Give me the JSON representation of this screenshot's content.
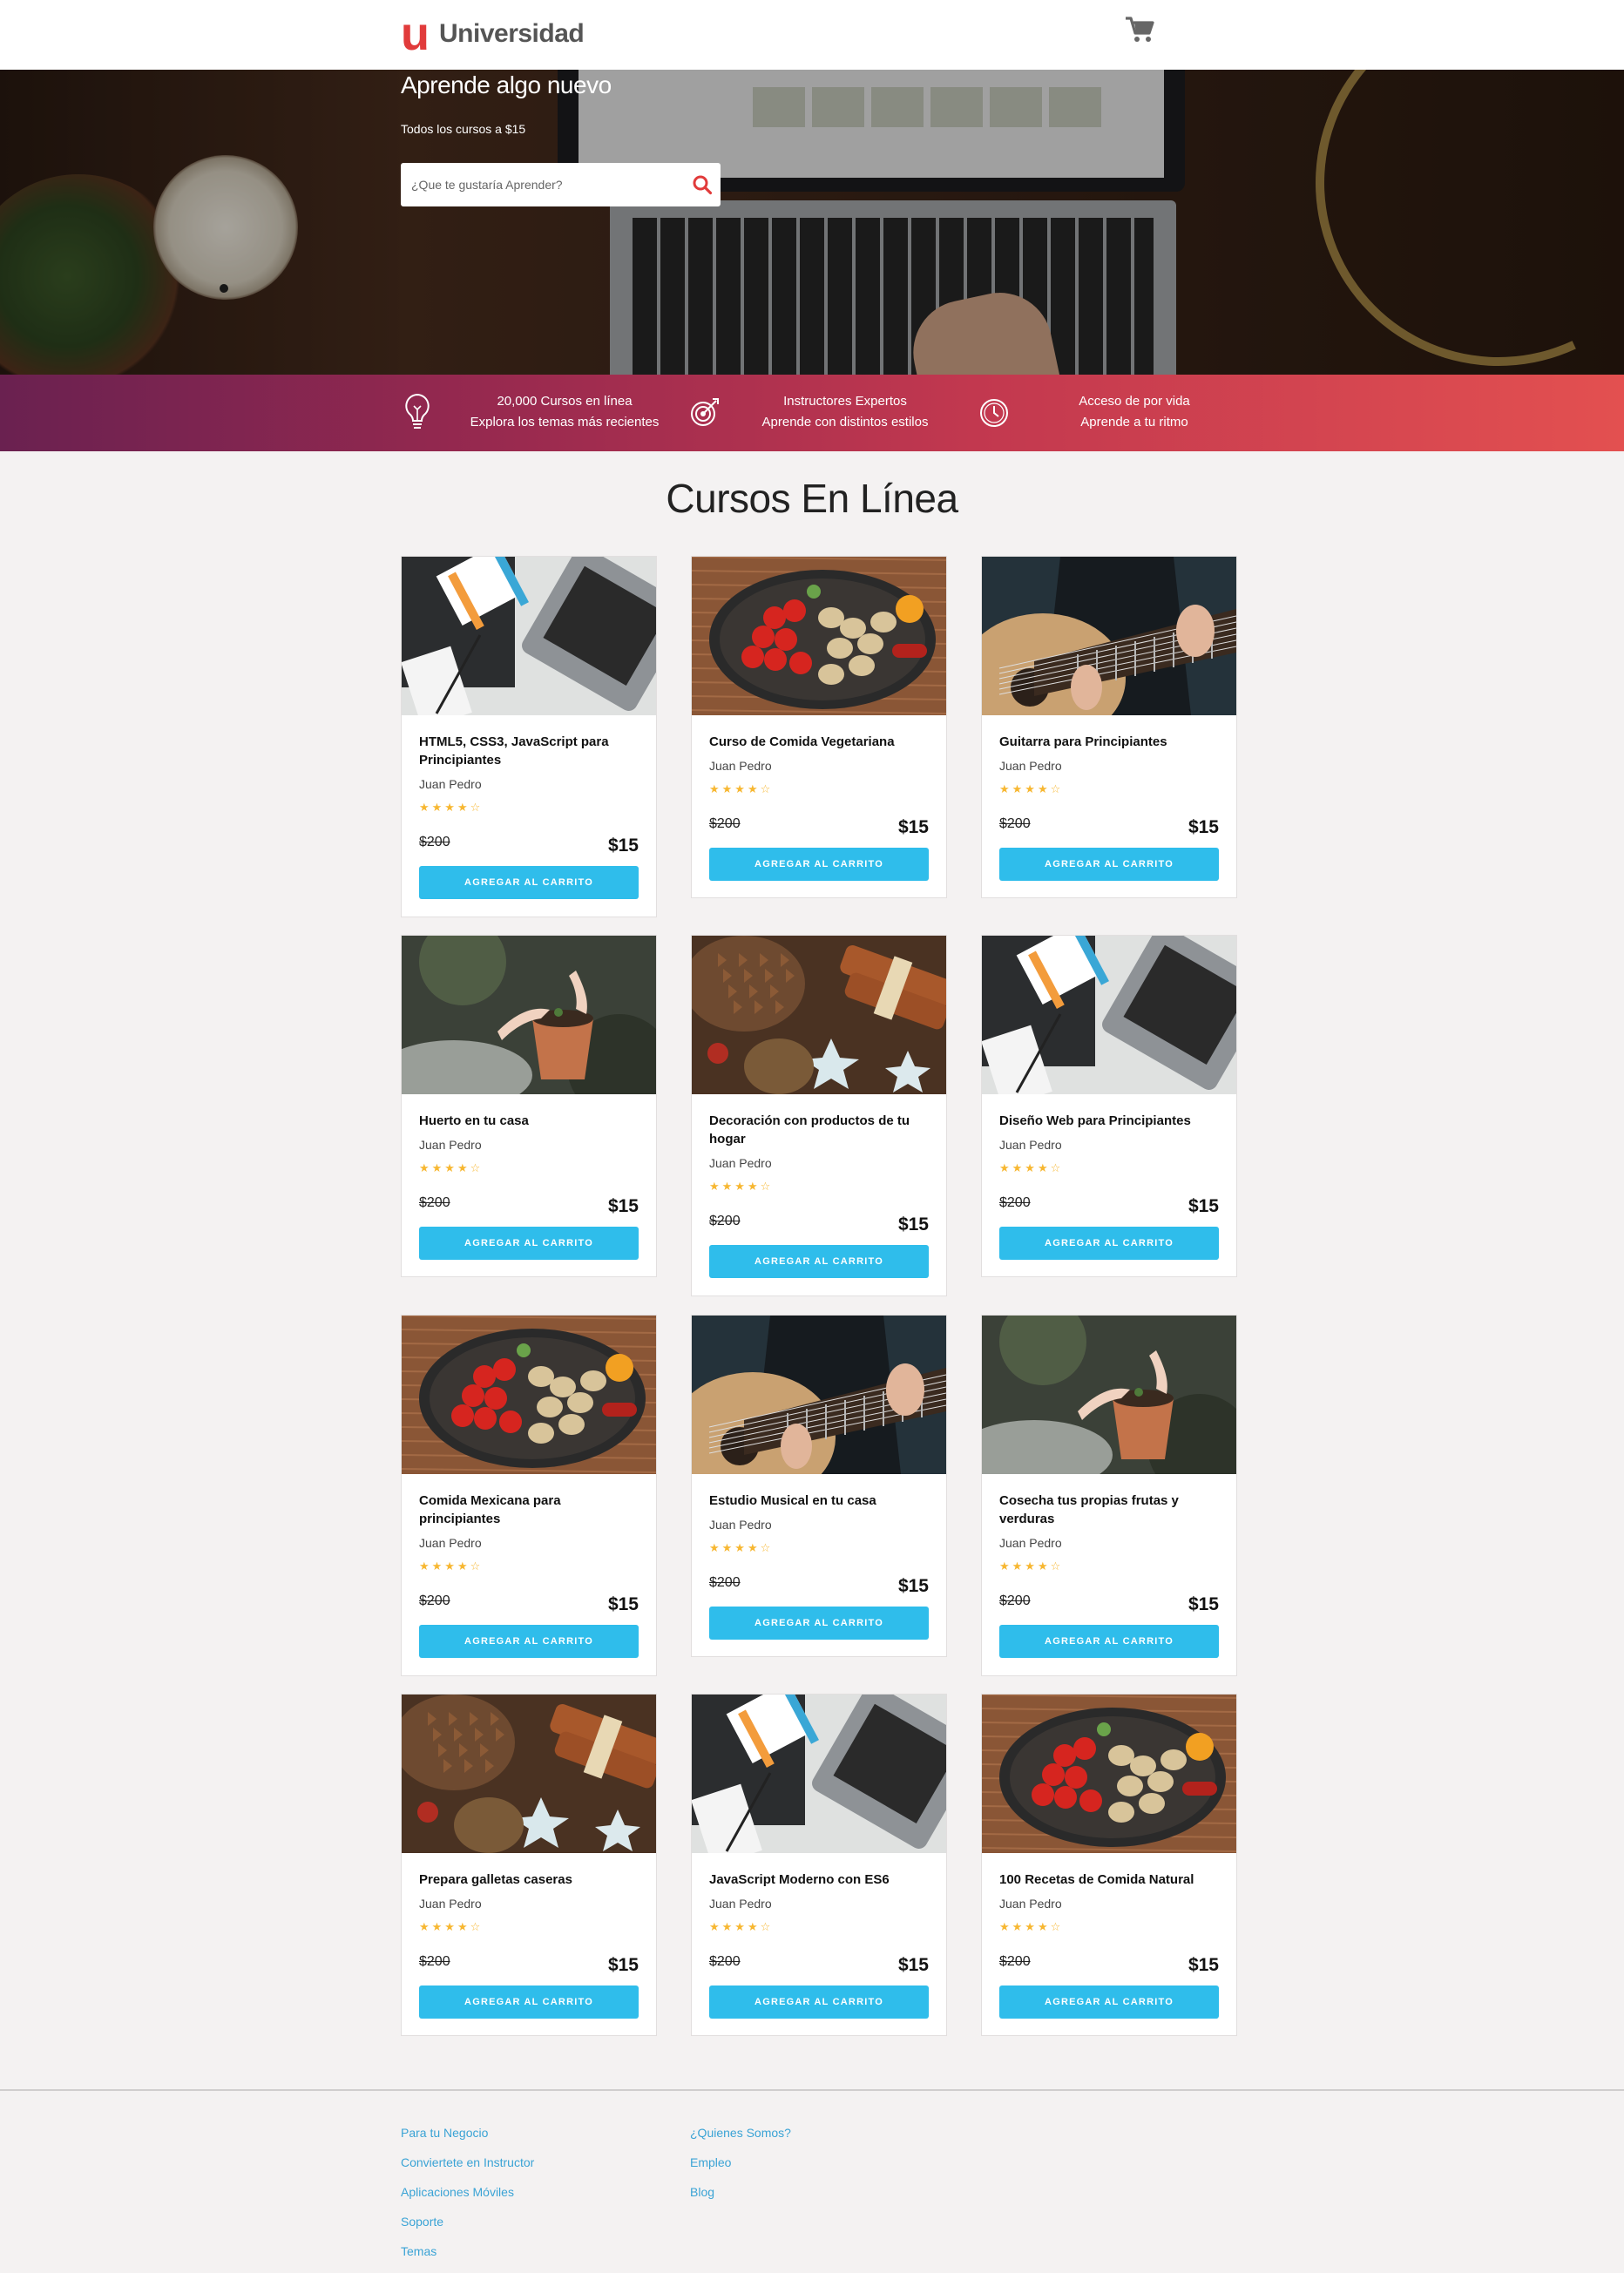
{
  "header": {
    "logo_mark": "u",
    "logo_text": "Universidad",
    "cart_icon": "shopping-cart-icon"
  },
  "hero": {
    "title": "Aprende algo nuevo",
    "subtitle": "Todos los cursos a $15",
    "search_placeholder": "¿Que te gustaría Aprender?",
    "search_icon": "search-icon"
  },
  "features": [
    {
      "icon": "lightbulb-icon",
      "line1": "20,000 Cursos en línea",
      "line2": "Explora los temas más recientes"
    },
    {
      "icon": "target-icon",
      "line1": "Instructores Expertos",
      "line2": "Aprende con distintos estilos"
    },
    {
      "icon": "clock-icon",
      "line1": "Acceso de por vida",
      "line2": "Aprende a tu ritmo"
    }
  ],
  "section_title": "Cursos En Línea",
  "colors": {
    "accent_button": "#2fbdeb",
    "brand_red": "#e13b3b",
    "star": "#f7b731",
    "link": "#3aa3d5"
  },
  "courses": [
    {
      "title": "HTML5, CSS3, JavaScript para Principiantes",
      "author": "Juan Pedro",
      "rating": 4.5,
      "stars": "★★★★☆",
      "old_price": "$200",
      "price": "$15",
      "button": "AGREGAR AL CARRITO",
      "image": "code"
    },
    {
      "title": "Curso de Comida Vegetariana",
      "author": "Juan Pedro",
      "rating": 4.5,
      "stars": "★★★★☆",
      "old_price": "$200",
      "price": "$15",
      "button": "AGREGAR AL CARRITO",
      "image": "food"
    },
    {
      "title": "Guitarra para Principiantes",
      "author": "Juan Pedro",
      "rating": 4.5,
      "stars": "★★★★☆",
      "old_price": "$200",
      "price": "$15",
      "button": "AGREGAR AL CARRITO",
      "image": "guitar"
    },
    {
      "title": "Huerto en tu casa",
      "author": "Juan Pedro",
      "rating": 4.5,
      "stars": "★★★★☆",
      "old_price": "$200",
      "price": "$15",
      "button": "AGREGAR AL CARRITO",
      "image": "garden"
    },
    {
      "title": "Decoración con productos de tu hogar",
      "author": "Juan Pedro",
      "rating": 4.5,
      "stars": "★★★★☆",
      "old_price": "$200",
      "price": "$15",
      "button": "AGREGAR AL CARRITO",
      "image": "decor"
    },
    {
      "title": "Diseño Web para Principiantes",
      "author": "Juan Pedro",
      "rating": 4.5,
      "stars": "★★★★☆",
      "old_price": "$200",
      "price": "$15",
      "button": "AGREGAR AL CARRITO",
      "image": "code"
    },
    {
      "title": "Comida Mexicana para principiantes",
      "author": "Juan Pedro",
      "rating": 4.5,
      "stars": "★★★★☆",
      "old_price": "$200",
      "price": "$15",
      "button": "AGREGAR AL CARRITO",
      "image": "food"
    },
    {
      "title": "Estudio Musical en tu casa",
      "author": "Juan Pedro",
      "rating": 4.5,
      "stars": "★★★★☆",
      "old_price": "$200",
      "price": "$15",
      "button": "AGREGAR AL CARRITO",
      "image": "guitar"
    },
    {
      "title": "Cosecha tus propias frutas y verduras",
      "author": "Juan Pedro",
      "rating": 4.5,
      "stars": "★★★★☆",
      "old_price": "$200",
      "price": "$15",
      "button": "AGREGAR AL CARRITO",
      "image": "garden"
    },
    {
      "title": "Prepara galletas caseras",
      "author": "Juan Pedro",
      "rating": 4.5,
      "stars": "★★★★☆",
      "old_price": "$200",
      "price": "$15",
      "button": "AGREGAR AL CARRITO",
      "image": "decor"
    },
    {
      "title": "JavaScript Moderno con ES6",
      "author": "Juan Pedro",
      "rating": 4.5,
      "stars": "★★★★☆",
      "old_price": "$200",
      "price": "$15",
      "button": "AGREGAR AL CARRITO",
      "image": "code"
    },
    {
      "title": "100 Recetas de Comida Natural",
      "author": "Juan Pedro",
      "rating": 4.5,
      "stars": "★★★★☆",
      "old_price": "$200",
      "price": "$15",
      "button": "AGREGAR AL CARRITO",
      "image": "food"
    }
  ],
  "footer": {
    "col1": [
      "Para tu Negocio",
      "Conviertete en Instructor",
      "Aplicaciones Móviles",
      "Soporte",
      "Temas"
    ],
    "col2": [
      "¿Quienes Somos?",
      "Empleo",
      "Blog"
    ]
  }
}
